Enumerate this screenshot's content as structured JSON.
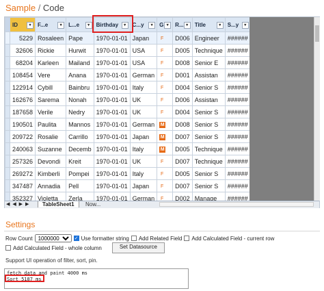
{
  "breadcrumb": {
    "first": "Sample",
    "sep": " / ",
    "second": "Code"
  },
  "columns": [
    "ID",
    "F...e",
    "L...e",
    "Birthday",
    "C...y",
    "G...r",
    "R...n",
    "Title",
    "S...y"
  ],
  "rows": [
    {
      "id": "5229",
      "first": "Rosaleen",
      "last": "Pape",
      "birthday": "1970-01-01",
      "country": "Japan",
      "gender": "F",
      "region": "D006",
      "title": "Engineer",
      "salary": "######"
    },
    {
      "id": "32606",
      "first": "Rickie",
      "last": "Hurwit",
      "birthday": "1970-01-01",
      "country": "USA",
      "gender": "F",
      "region": "D005",
      "title": "Technique",
      "salary": "######"
    },
    {
      "id": "68204",
      "first": "Karleen",
      "last": "Mailand",
      "birthday": "1970-01-01",
      "country": "USA",
      "gender": "F",
      "region": "D008",
      "title": "Senior E",
      "salary": "######"
    },
    {
      "id": "108454",
      "first": "Vere",
      "last": "Anana",
      "birthday": "1970-01-01",
      "country": "German",
      "gender": "F",
      "region": "D001",
      "title": "Assistan",
      "salary": "######"
    },
    {
      "id": "122914",
      "first": "Cybill",
      "last": "Bainbru",
      "birthday": "1970-01-01",
      "country": "Italy",
      "gender": "F",
      "region": "D004",
      "title": "Senior S",
      "salary": "######"
    },
    {
      "id": "162676",
      "first": "Sarema",
      "last": "Nonah",
      "birthday": "1970-01-01",
      "country": "UK",
      "gender": "F",
      "region": "D006",
      "title": "Assistan",
      "salary": "######"
    },
    {
      "id": "187658",
      "first": "Verile",
      "last": "Nedry",
      "birthday": "1970-01-01",
      "country": "UK",
      "gender": "F",
      "region": "D004",
      "title": "Senior S",
      "salary": "######"
    },
    {
      "id": "190501",
      "first": "Paulita",
      "last": "Mannos",
      "birthday": "1970-01-01",
      "country": "German",
      "gender": "M",
      "region": "D008",
      "title": "Senior S",
      "salary": "######"
    },
    {
      "id": "209722",
      "first": "Rosalie",
      "last": "Carrillo",
      "birthday": "1970-01-01",
      "country": "Japan",
      "gender": "M",
      "region": "D007",
      "title": "Senior S",
      "salary": "######"
    },
    {
      "id": "240063",
      "first": "Suzanne",
      "last": "Decemb",
      "birthday": "1970-01-01",
      "country": "Italy",
      "gender": "M",
      "region": "D005",
      "title": "Technique",
      "salary": "######"
    },
    {
      "id": "257326",
      "first": "Devondi",
      "last": "Kreit",
      "birthday": "1970-01-01",
      "country": "UK",
      "gender": "F",
      "region": "D007",
      "title": "Technique",
      "salary": "######"
    },
    {
      "id": "269272",
      "first": "Kimberli",
      "last": "Pompei",
      "birthday": "1970-01-01",
      "country": "Italy",
      "gender": "F",
      "region": "D005",
      "title": "Senior S",
      "salary": "######"
    },
    {
      "id": "347487",
      "first": "Annadia",
      "last": "Pell",
      "birthday": "1970-01-01",
      "country": "Japan",
      "gender": "F",
      "region": "D007",
      "title": "Senior S",
      "salary": "######"
    },
    {
      "id": "352327",
      "first": "Violetta",
      "last": "Zerla",
      "birthday": "1970-01-01",
      "country": "German",
      "gender": "F",
      "region": "D002",
      "title": "Manage",
      "salary": "######"
    },
    {
      "id": "353979",
      "first": "Corabell",
      "last": "Perry",
      "birthday": "1970-01-01",
      "country": "Italy",
      "gender": "F",
      "region": "D005",
      "title": "Senior S",
      "salary": "######"
    }
  ],
  "tabs": {
    "nav": "◀ ◀ ▶ ▶",
    "sheet1": "TableSheet1",
    "sheet2": "Now..."
  },
  "settings": {
    "title": "Settings",
    "row_count_label": "Row Count",
    "row_count_value": "1000000",
    "use_formatter": "Use formatter string",
    "add_related": "Add Related Field",
    "add_calc_current": "Add Calculated Field - current row",
    "add_calc_whole": "Add Calculated Field - whole column",
    "set_datasource": "Set Datasource",
    "support_text": "Support UI operation of filter, sort, pin.",
    "log_line1": "fetch data and paint 4000 ms",
    "log_line2": "Sort 5187 ms"
  },
  "colors": {
    "accent": "#e8761e",
    "highlight": "#e02020",
    "header": "#dbe6f3"
  }
}
